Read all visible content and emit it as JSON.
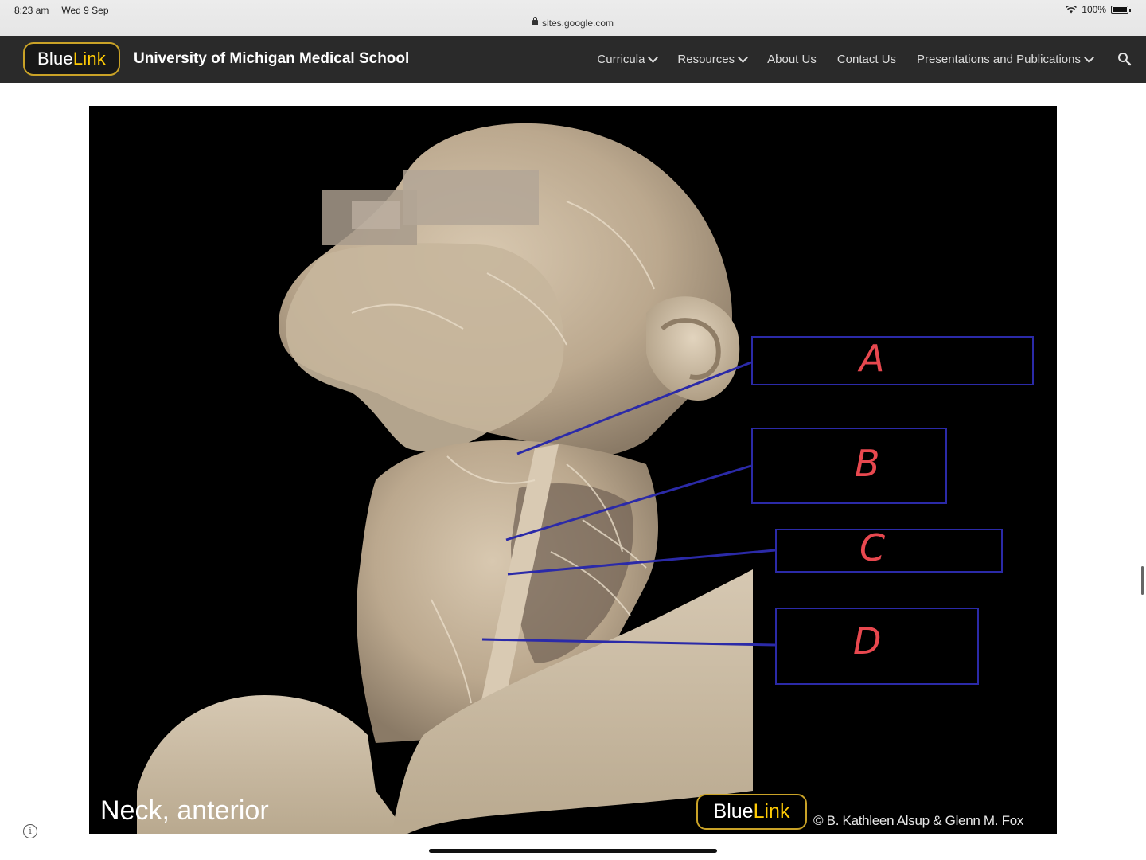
{
  "status_bar": {
    "time": "8:23 am",
    "date": "Wed 9 Sep",
    "battery": "100%",
    "battery_level": 1.0,
    "url": "sites.google.com"
  },
  "nav": {
    "logo_blue": "Blue",
    "logo_link": "Link",
    "site_title": "University of Michigan Medical School",
    "menu": [
      {
        "label": "Curricula",
        "dropdown": true
      },
      {
        "label": "Resources",
        "dropdown": true
      },
      {
        "label": "About Us",
        "dropdown": false
      },
      {
        "label": "Contact Us",
        "dropdown": false
      },
      {
        "label": "Presentations and Publications",
        "dropdown": true
      }
    ],
    "search_icon": "search-icon"
  },
  "figure": {
    "caption": "Neck, anterior",
    "logo_blue": "Blue",
    "logo_link": "Link",
    "credit": "© B. Kathleen Alsup & Glenn M. Fox",
    "labels": [
      "A",
      "B",
      "C",
      "D"
    ],
    "label_color": "#e8484f",
    "box_color": "#2b2aa8"
  },
  "colors": {
    "nav_bg": "#2a2a2a",
    "brand_gold": "#ffcb05",
    "figure_bg": "#000000"
  }
}
